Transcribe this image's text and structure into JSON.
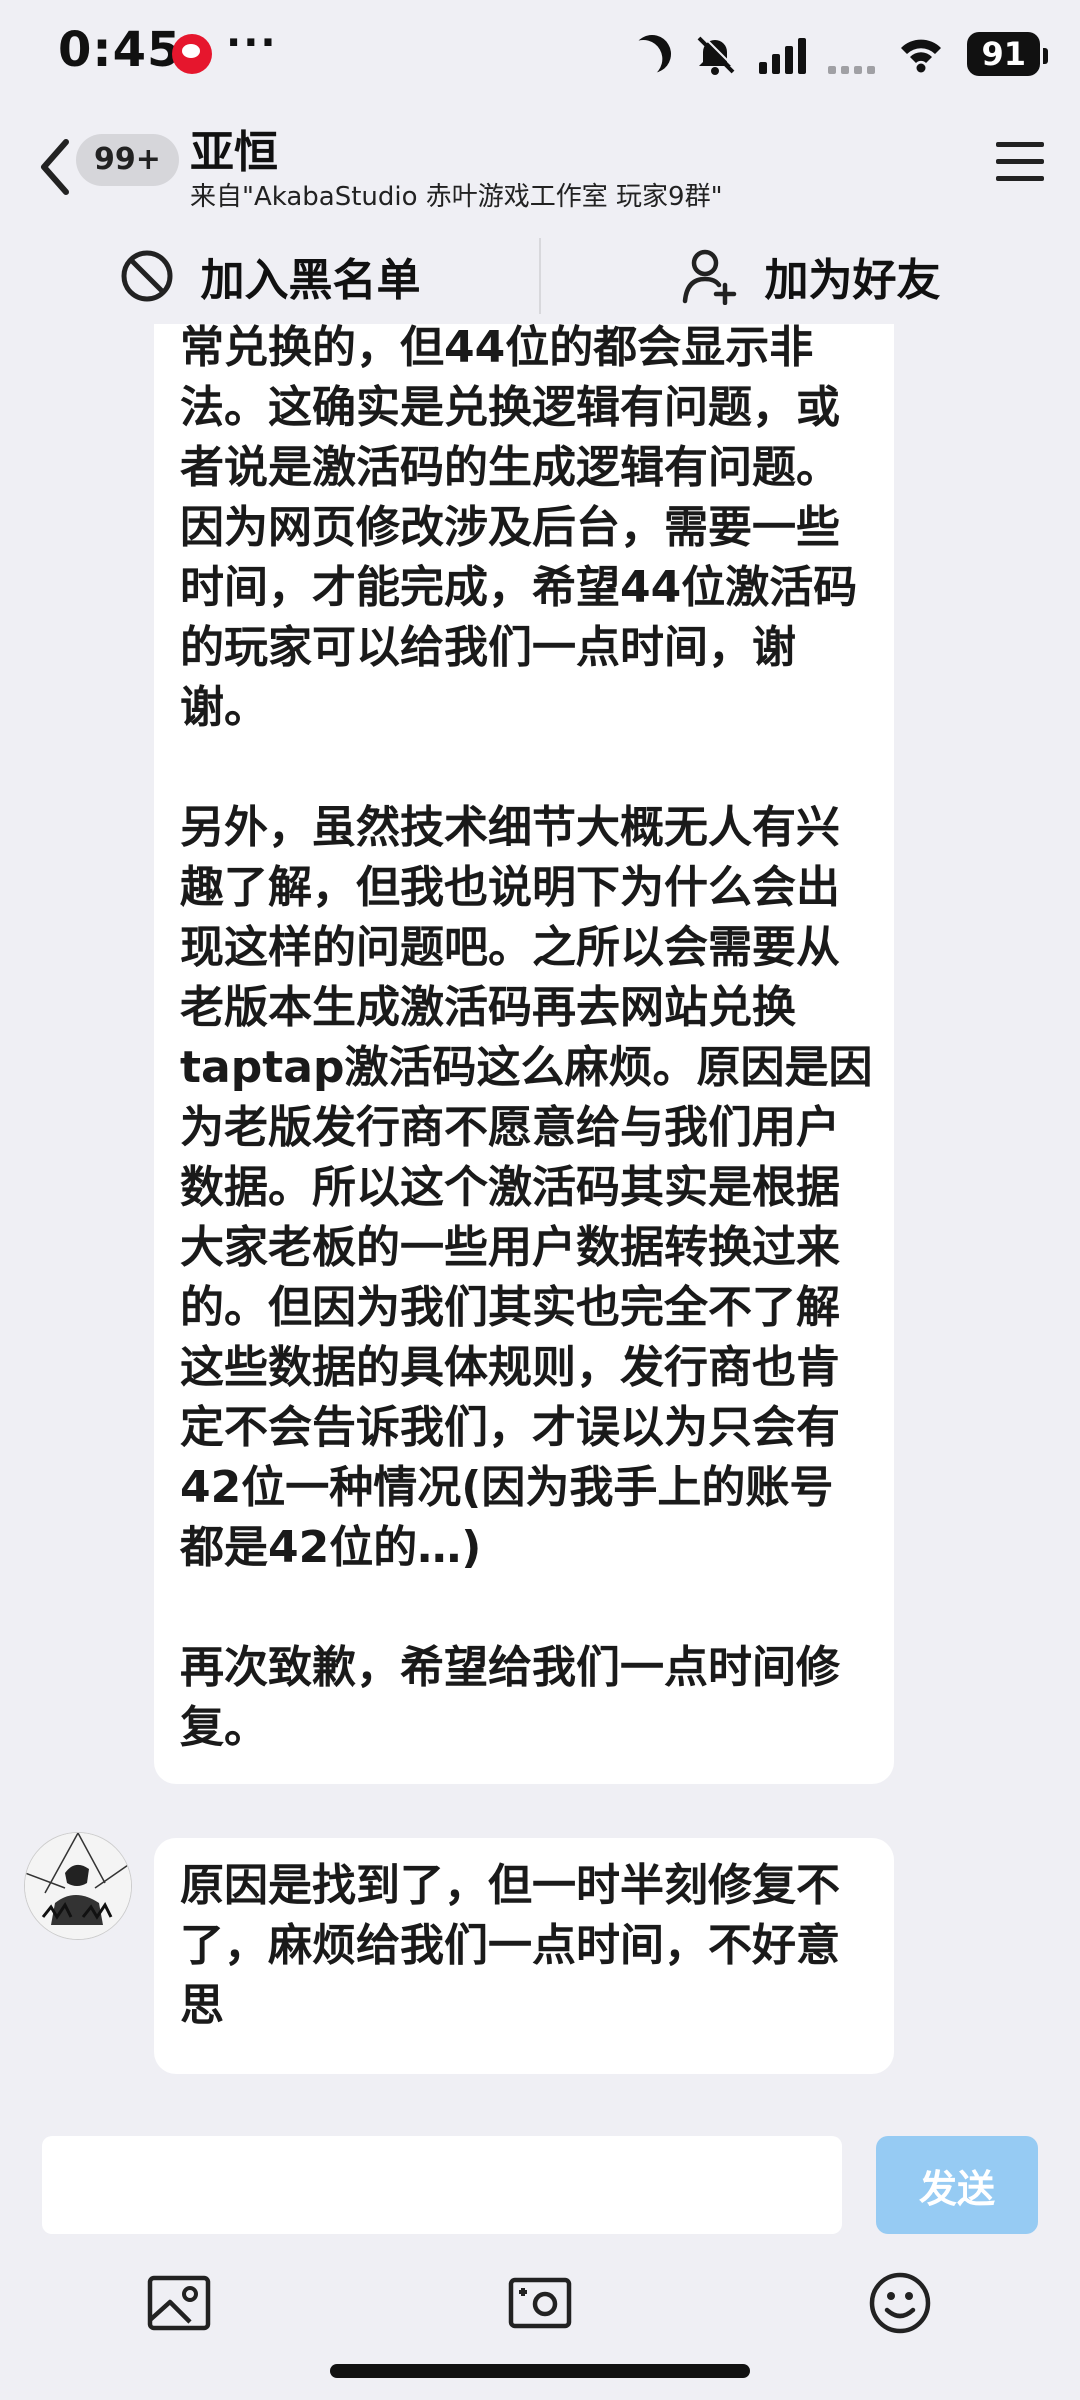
{
  "status_bar": {
    "time": "0:45",
    "dots": "···",
    "battery": "91"
  },
  "header": {
    "back_badge": "99+",
    "contact_name": "亚恒",
    "contact_source": "来自\"AkabaStudio 赤叶游戏工作室 玩家9群\""
  },
  "actions": {
    "block_label": "加入黑名单",
    "add_friend_label": "加为好友"
  },
  "messages": [
    {
      "text": "常兑换的，但44位的都会显示非法。这确实是兑换逻辑有问题，或者说是激活码的生成逻辑有问题。因为网页修改涉及后台，需要一些时间，才能完成，希望44位激活码的玩家可以给我们一点时间，谢谢。\n\n另外，虽然技术细节大概无人有兴趣了解，但我也说明下为什么会出现这样的问题吧。之所以会需要从老版本生成激活码再去网站兑换taptap激活码这么麻烦。原因是因为老版发行商不愿意给与我们用户数据。所以这个激活码其实是根据大家老板的一些用户数据转换过来的。但因为我们其实也完全不了解这些数据的具体规则，发行商也肯定不会告诉我们，才误以为只会有42位一种情况(因为我手上的账号都是42位的…)\n\n再次致歉，希望给我们一点时间修复。"
    },
    {
      "text": "原因是找到了，但一时半刻修复不了，麻烦给我们一点时间，不好意思"
    }
  ],
  "input": {
    "placeholder": "",
    "value": "",
    "send_label": "发送"
  },
  "colors": {
    "background": "#efeff4",
    "bubble": "#ffffff",
    "send_button": "#96cbf3"
  },
  "icons": [
    "moon-icon",
    "silent-bell-icon",
    "cell-signal-icon",
    "wifi-icon",
    "back-chevron-icon",
    "menu-icon",
    "block-icon",
    "add-user-icon",
    "image-icon",
    "camera-icon",
    "emoji-icon"
  ]
}
